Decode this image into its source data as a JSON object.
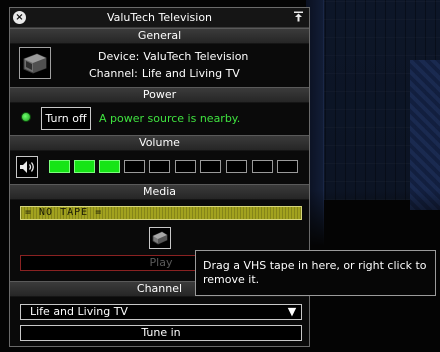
{
  "window": {
    "title": "ValuTech Television"
  },
  "general": {
    "header": "General",
    "device_label": "Device:",
    "device_value": "ValuTech Television",
    "channel_label": "Channel:",
    "channel_value": "Life and Living TV",
    "device_icon": "television-icon"
  },
  "power": {
    "header": "Power",
    "led_color": "#2fd12f",
    "button_label": "Turn off",
    "status_text": "A power source is nearby.",
    "status_color": "#3fe23f"
  },
  "volume": {
    "header": "Volume",
    "icon": "speaker-icon",
    "level": 3,
    "max": 10,
    "on_color": "#16e516"
  },
  "media": {
    "header": "Media",
    "tape_display": "= NO TAPE =",
    "tape_icon": "vhs-tape-icon",
    "play_label": "Play"
  },
  "channel": {
    "header": "Channel",
    "selected": "Life and Living TV",
    "tune_label": "Tune in"
  },
  "tooltip": {
    "text": "Drag a VHS tape in here, or right click to remove it."
  }
}
